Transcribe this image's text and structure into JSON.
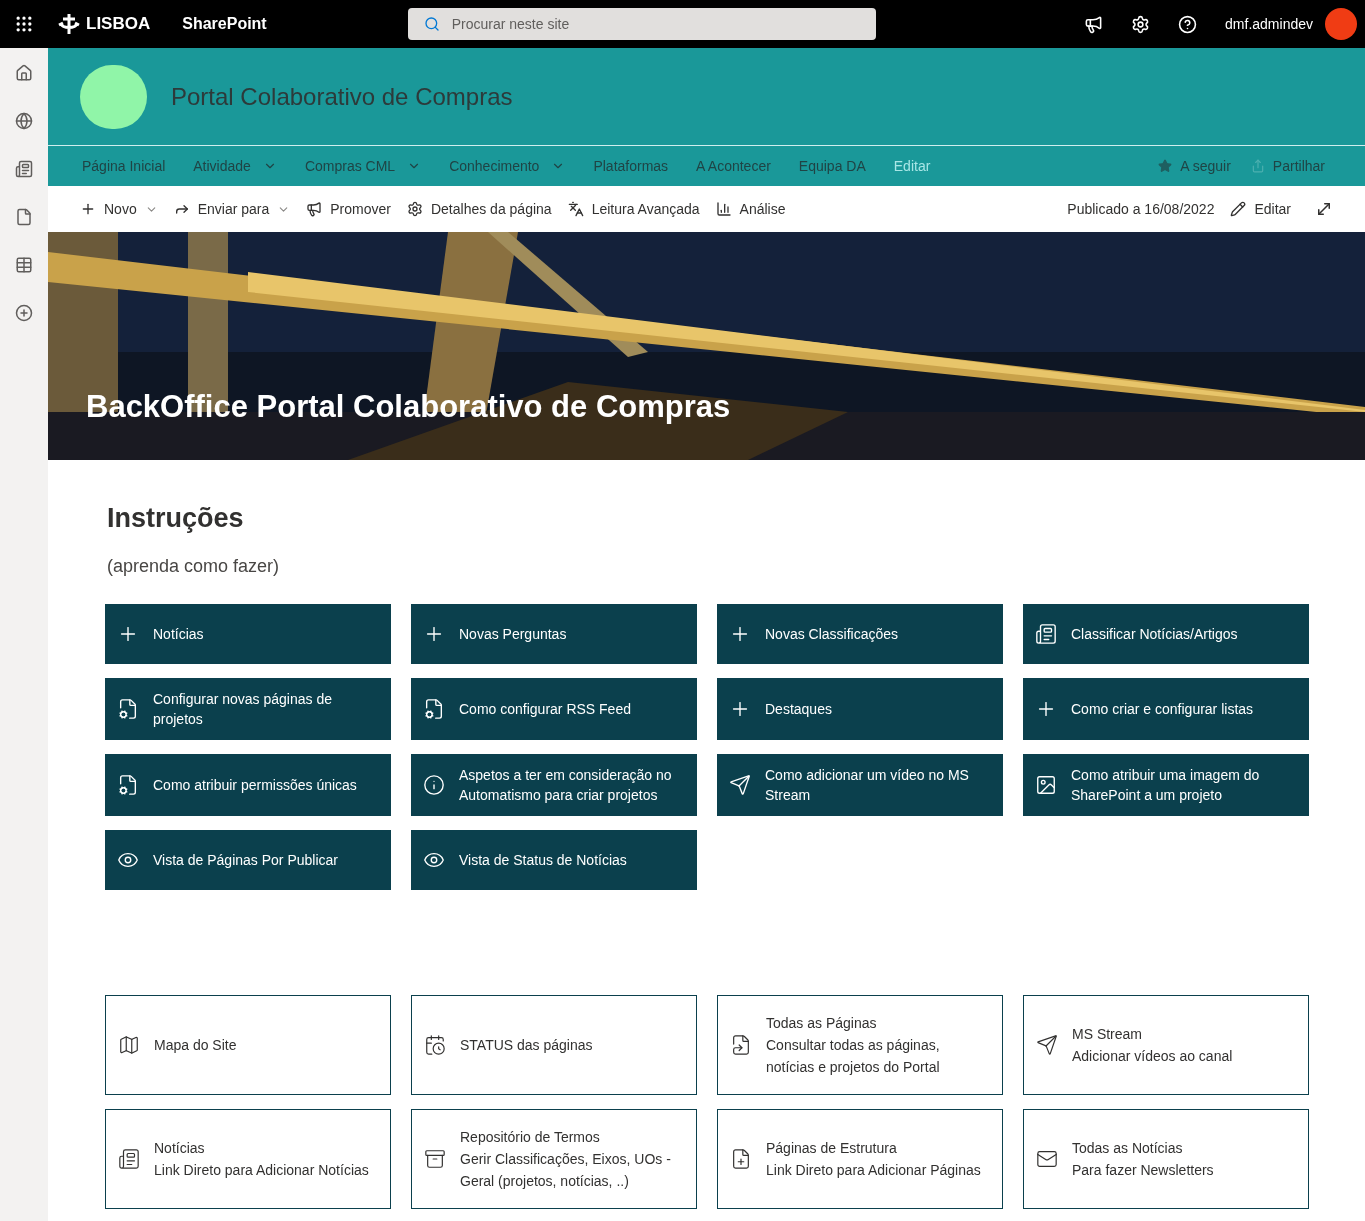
{
  "topbar": {
    "brand": "LISBOA",
    "app": "SharePoint",
    "search": {
      "placeholder": "Procurar neste site"
    },
    "user": "dmf.admindev"
  },
  "site": {
    "title": "Portal Colaborativo de Compras"
  },
  "nav": [
    {
      "label": "Página Inicial",
      "has_menu": false,
      "disabled": false
    },
    {
      "label": "Atividade",
      "has_menu": true,
      "disabled": false
    },
    {
      "label": "Compras CML",
      "has_menu": true,
      "disabled": false
    },
    {
      "label": "Conhecimento",
      "has_menu": true,
      "disabled": false
    },
    {
      "label": "Plataformas",
      "has_menu": false,
      "disabled": false
    },
    {
      "label": "A Acontecer",
      "has_menu": false,
      "disabled": false
    },
    {
      "label": "Equipa DA",
      "has_menu": false,
      "disabled": false
    },
    {
      "label": "Editar",
      "has_menu": false,
      "disabled": true
    }
  ],
  "site_actions": [
    "A seguir",
    "Partilhar"
  ],
  "commands": [
    {
      "label": "Novo",
      "has_menu": true
    },
    {
      "label": "Enviar para",
      "has_menu": true
    },
    {
      "label": "Promover",
      "has_menu": false
    },
    {
      "label": "Detalhes da página",
      "has_menu": false
    },
    {
      "label": "Leitura Avançada",
      "has_menu": false
    },
    {
      "label": "Análise",
      "has_menu": false
    }
  ],
  "published": "Publicado a 16/08/2022",
  "edit": "Editar",
  "hero": {
    "kind": "picture",
    "title": "BackOffice Portal Colaborativo de Compras"
  },
  "section": {
    "title": "Instruções",
    "subtitle": "(aprenda como fazer)"
  },
  "instruction_tiles": [
    {
      "label": "Notícias"
    },
    {
      "label": "Novas Perguntas"
    },
    {
      "label": "Novas Classificações"
    },
    {
      "label": "Classificar Notícias/Artigos"
    },
    {
      "label": "Configurar novas páginas de projetos"
    },
    {
      "label": "Como configurar RSS Feed"
    },
    {
      "label": "Destaques"
    },
    {
      "label": "Como criar e configurar listas"
    },
    {
      "label": "Como atribuir permissões únicas"
    },
    {
      "label": "Aspetos a ter em consideração no Automatismo para criar projetos"
    },
    {
      "label": "Como adicionar um vídeo no MS Stream"
    },
    {
      "label": "Como atribuir uma imagem do SharePoint a um projeto"
    },
    {
      "label": "Vista de Páginas Por Publicar"
    },
    {
      "label": "Vista de Status de Notícias"
    }
  ],
  "link_tiles": [
    {
      "title": "Mapa do Site"
    },
    {
      "title": "STATUS das páginas"
    },
    {
      "title": "Todas as Páginas",
      "description": "Consultar todas as páginas, notícias e projetos do Portal"
    },
    {
      "title": "MS Stream",
      "description": "Adicionar vídeos ao canal"
    },
    {
      "title": "Notícias",
      "description": "Link Direto para Adicionar Notícias"
    },
    {
      "title": "Repositório de Termos",
      "description": "Gerir Classificações, Eixos, UOs - Geral (projetos, notícias, ..)"
    },
    {
      "title": "Páginas de Estrutura",
      "description": "Link Direto para Adicionar Páginas"
    },
    {
      "title": "Todas as Notícias",
      "description": "Para fazer Newsletters"
    }
  ]
}
